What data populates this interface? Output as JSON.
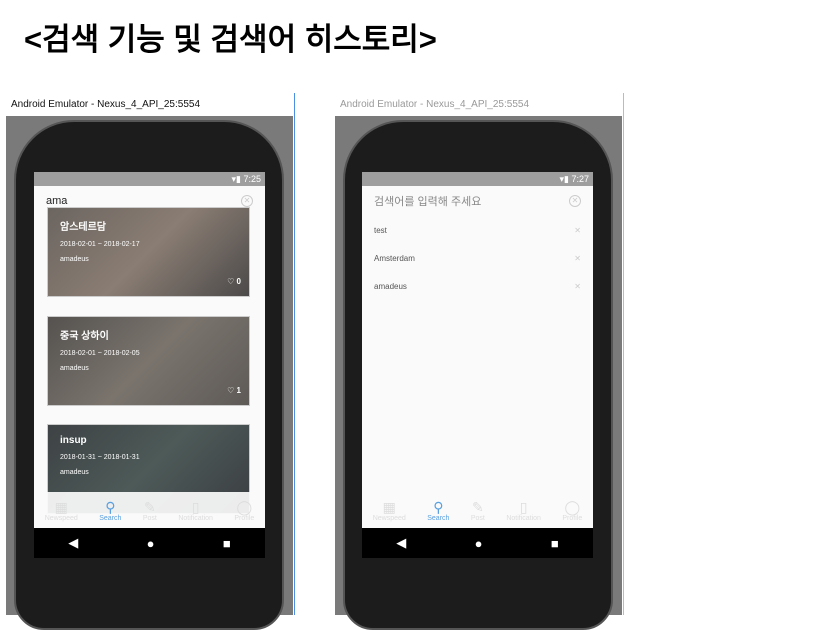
{
  "heading": "<검색 기능 및 검색어 히스토리>",
  "left": {
    "window_title": "Android Emulator - Nexus_4_API_25:5554",
    "time": "7:25",
    "query": "ama",
    "cards": [
      {
        "title": "암스테르담",
        "dates": "2018-02-01 ~ 2018-02-17",
        "user": "amadeus",
        "likes": "0"
      },
      {
        "title": "중국 상하이",
        "dates": "2018-02-01 ~ 2018-02-05",
        "user": "amadeus",
        "likes": "1"
      },
      {
        "title": "insup",
        "dates": "2018-01-31 ~ 2018-01-31",
        "user": "amadeus"
      }
    ]
  },
  "right": {
    "window_title": "Android Emulator - Nexus_4_API_25:5554",
    "time": "7:27",
    "placeholder": "검색어를 입력해 주세요",
    "history": [
      "test",
      "Amsterdam",
      "amadeus"
    ]
  },
  "bottom_nav": [
    "Newspeed",
    "Search",
    "Post",
    "Notification",
    "Profile"
  ],
  "nav_icons": [
    "grid-icon",
    "search-icon",
    "pencil-icon",
    "notification-icon",
    "profile-icon"
  ]
}
